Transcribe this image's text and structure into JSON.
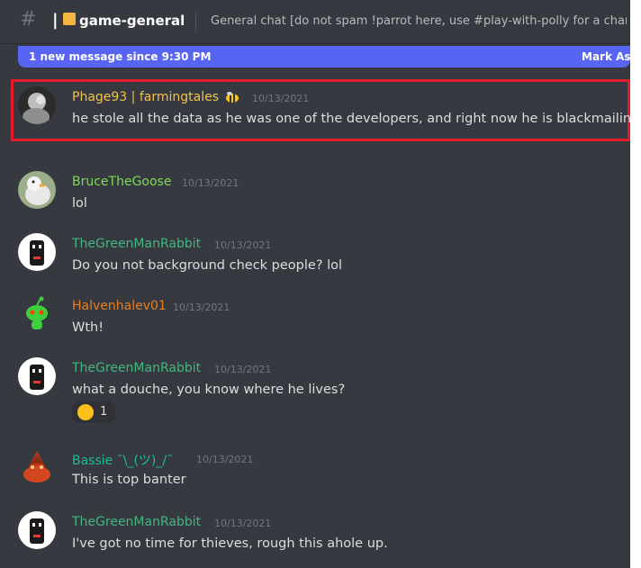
{
  "header": {
    "channel_prefix": "|",
    "channel_name": "game-general",
    "topic": "General chat [do not spam !parrot here, use #play-with-polly for a chanc..."
  },
  "banner": {
    "text": "1 new message since 9:30 PM",
    "action": "Mark As"
  },
  "colors": {
    "background": "#36393f",
    "accent": "#5865f2",
    "highlight_border": "#e11d2a",
    "username_gold": "#f0c24a",
    "username_green": "#43b581",
    "username_bright_green": "#7ed957",
    "username_orange": "#e67e22",
    "username_teal": "#1abc9c"
  },
  "messages": [
    {
      "author": "Phage93 | farmingtales",
      "timestamp": "10/13/2021",
      "text": "he stole all the data as he was one of the developers, and right now he is blackmailing us",
      "avatar": "grey-blur-avatar",
      "badge": "bee-emoji"
    },
    {
      "author": "BruceTheGoose",
      "timestamp": "10/13/2021",
      "text": "lol",
      "avatar": "goose-avatar"
    },
    {
      "author": "TheGreenManRabbit",
      "timestamp": "10/13/2021",
      "text": "Do you not background check people?  lol",
      "avatar": "rabbit-avatar"
    },
    {
      "author": "Halvenhalev01",
      "timestamp": "10/13/2021",
      "text": "Wth!",
      "avatar": "reddit-alien-avatar"
    },
    {
      "author": "TheGreenManRabbit",
      "timestamp": "10/13/2021",
      "text": "what a douche, you know where he lives?",
      "avatar": "rabbit-avatar",
      "reaction": {
        "emoji": "grinning-squint-emoji",
        "count": "1"
      }
    },
    {
      "author": "Bassie ¯\\_(ツ)_/¯",
      "timestamp": "10/13/2021",
      "text": "This is top banter",
      "avatar": "orange-creature-avatar"
    },
    {
      "author": "TheGreenManRabbit",
      "timestamp": "10/13/2021",
      "text": "I've got no time for thieves, rough this ahole up.",
      "avatar": "rabbit-avatar"
    }
  ]
}
